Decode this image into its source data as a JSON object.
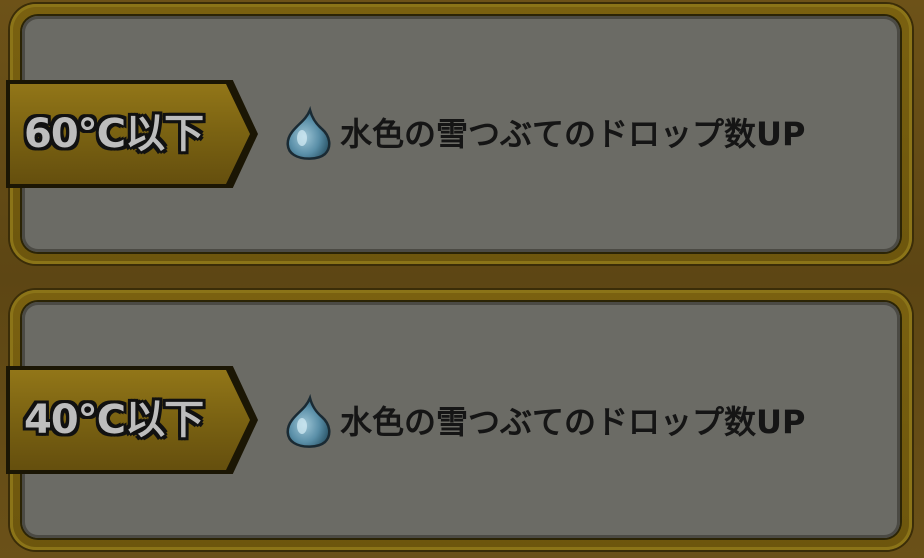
{
  "rows": [
    {
      "threshold": "60℃以下",
      "icon": "water-drop-icon",
      "description": "水色の雪つぶてのドロップ数UP"
    },
    {
      "threshold": "40℃以下",
      "icon": "water-drop-icon",
      "description": "水色の雪つぶてのドロップ数UP"
    }
  ],
  "colors": {
    "frame_gold": "#7a6110",
    "panel_gray": "#6b6b65",
    "label_text": "#bdbdbd",
    "description_text": "#151515",
    "drop_blue": "#5a8fa8"
  }
}
